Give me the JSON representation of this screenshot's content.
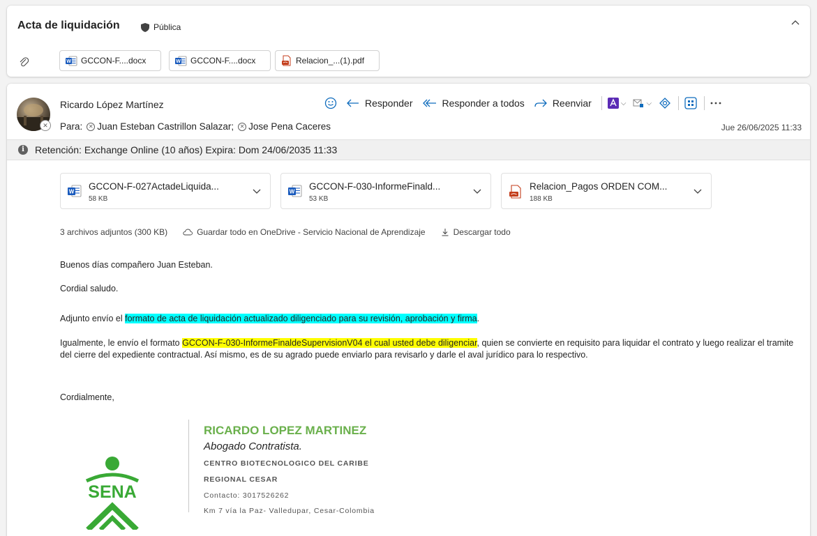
{
  "subject": {
    "title": "Acta de liquidación",
    "sensitivity": "Pública"
  },
  "top_attachments": [
    {
      "label": "GCCON-F....docx",
      "icon": "word-icon"
    },
    {
      "label": "GCCON-F....docx",
      "icon": "word-icon"
    },
    {
      "label": "Relacion_...(1).pdf",
      "icon": "pdf-icon"
    }
  ],
  "message": {
    "sender": "Ricardo López Martínez",
    "to_label": "Para:",
    "recipients": [
      "Juan Esteban Castrillon Salazar;",
      "Jose Pena Caceres"
    ],
    "date": "Jue 26/06/2025 11:33",
    "actions": {
      "reply": "Responder",
      "reply_all": "Responder a todos",
      "forward": "Reenviar"
    },
    "retention": "Retención: Exchange Online (10 años) Expira: Dom 24/06/2035 11:33",
    "attachments": [
      {
        "name": "GCCON-F-027ActadeLiquida...",
        "size": "58 KB",
        "icon": "word-icon"
      },
      {
        "name": "GCCON-F-030-InformeFinald...",
        "size": "53 KB",
        "icon": "word-icon"
      },
      {
        "name": "Relacion_Pagos ORDEN COM...",
        "size": "188 KB",
        "icon": "pdf-icon"
      }
    ],
    "attachment_summary": {
      "count": "3 archivos adjuntos (300 KB)",
      "save_all": "Guardar todo en OneDrive - Servicio Nacional de Aprendizaje",
      "download_all": "Descargar todo"
    },
    "body": {
      "greeting": "Buenos días compañero Juan Esteban.",
      "salutation": "Cordial saludo.",
      "p1_before": "Adjunto envío el ",
      "p1_highlight": "formato de acta de liquidación actualizado diligenciado para su revisión, aprobación y firma",
      "p1_after": ".",
      "p2_before": "Igualmente, le envío el formato ",
      "p2_highlight": "GCCON-F-030-InformeFinaldeSupervisionV04 el cual usted debe diligenciar",
      "p2_after": ", quien se convierte en requisito para liquidar el contrato y luego realizar el tramite del cierre del expediente contractual. Así mismo, es de su agrado puede enviarlo para revisarlo y darle el aval jurídico para lo respectivo.",
      "closing": "Cordialmente,"
    },
    "signature": {
      "name": "RICARDO LOPEZ MARTINEZ",
      "role": "Abogado Contratista.",
      "center": "CENTRO BIOTECNOLOGICO DEL CARIBE",
      "regional": "REGIONAL CESAR",
      "contact": "Contacto: 3017526262",
      "address": "Km 7 vía la Paz- Valledupar, Cesar-Colombia",
      "logo_text": "SENA"
    }
  },
  "colors": {
    "highlight_cyan": "#00ffff",
    "highlight_yellow": "#ffff00",
    "signature_green": "#6ab04c",
    "sena_green": "#39a935",
    "word_blue": "#185abd",
    "pdf_red": "#c43e1c",
    "accent_blue": "#0f6cbd"
  }
}
